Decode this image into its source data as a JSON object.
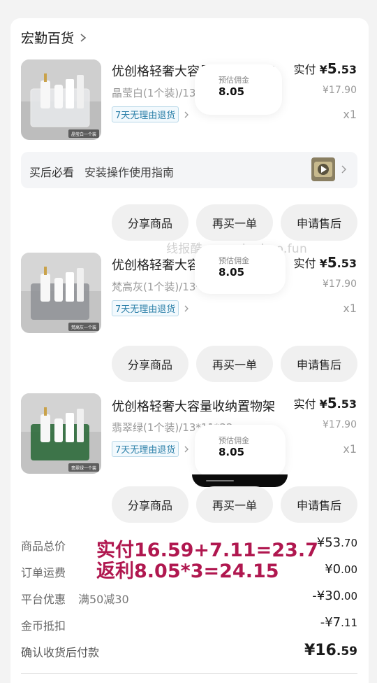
{
  "shop": {
    "name": "宏勤百货"
  },
  "watermark": "线报酷-new.xianbao.fun",
  "items": [
    {
      "title": "优创格轻奢大容量收纳置物架",
      "spec": "晶莹白(1个装)/13*11*22cm",
      "tag": "7天无理由退货",
      "paid_label": "实付",
      "paid_yen": "¥",
      "paid_int": "5",
      "paid_dec": ".53",
      "orig": "¥17.90",
      "qty": "x1",
      "thumb_caption": "晶莹白一个装",
      "box_color": "#e8eaec"
    },
    {
      "title": "优创格轻奢大容量收纳置物架",
      "spec": "梵高灰(1个装)/13*11*22cm",
      "tag": "7天无理由退货",
      "paid_label": "实付",
      "paid_yen": "¥",
      "paid_int": "5",
      "paid_dec": ".53",
      "orig": "¥17.90",
      "qty": "x1",
      "thumb_caption": "梵高灰一个装",
      "box_color": "#8f9296"
    },
    {
      "title": "优创格轻奢大容量收纳置物架",
      "spec": "翡翠绿(1个装)/13*11*22cm",
      "tag": "7天无理由退货",
      "paid_label": "实付",
      "paid_yen": "¥",
      "paid_int": "5",
      "paid_dec": ".53",
      "orig": "¥17.90",
      "qty": "x1",
      "thumb_caption": "翡翠绿一个装",
      "box_color": "#2f6b3c"
    }
  ],
  "popups": [
    {
      "label": "预估佣金",
      "value": "8.05"
    },
    {
      "label": "预估佣金",
      "value": "8.05"
    },
    {
      "label": "预估佣金",
      "value": "8.05"
    }
  ],
  "guide": {
    "title": "买后必看",
    "text": "安装操作使用指南"
  },
  "buttons": {
    "share": "分享商品",
    "rebuy": "再买一单",
    "aftersale": "申请售后"
  },
  "summary": {
    "total": {
      "label": "商品总价",
      "int": "¥53",
      "dec": ".70"
    },
    "shipping": {
      "label": "订单运费",
      "int": "¥0",
      "dec": ".00"
    },
    "discount": {
      "label": "平台优惠",
      "extra": "满50减30",
      "int": "-¥30",
      "dec": ".00"
    },
    "coins": {
      "label": "金币抵扣",
      "int": "-¥7",
      "dec": ".11"
    },
    "final": {
      "label": "确认收货后付款",
      "int": "¥16",
      "dec": ".59"
    }
  },
  "overlay": {
    "line1": "实付16.59+7.11=23.7",
    "line2": "返利8.05*3=24.15"
  },
  "colors": {
    "accent_text": "#b0174f",
    "tag_blue": "#2b7fa8"
  }
}
